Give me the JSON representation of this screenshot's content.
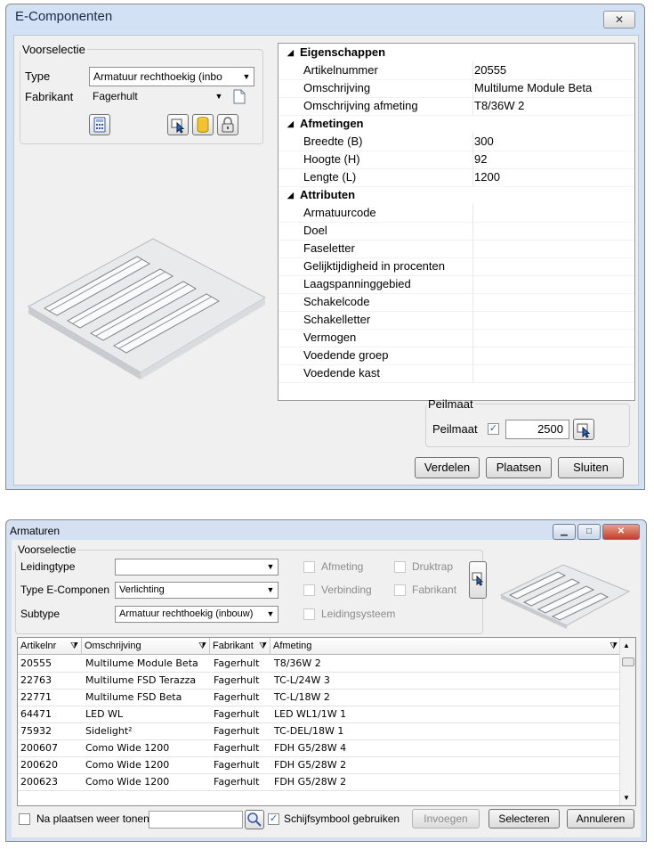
{
  "dialog": {
    "title": "E-Componenten",
    "close_glyph": "✕",
    "preselect": {
      "legend": "Voorselectie",
      "type_label": "Type",
      "type_value": "Armatuur rechthoekig (inbo",
      "manufacturer_label": "Fabrikant",
      "manufacturer_value": "Fagerhult"
    },
    "properties": {
      "group_properties": "Eigenschappen",
      "article_number_key": "Artikelnummer",
      "article_number_value": "20555",
      "description_key": "Omschrijving",
      "description_value": "Multilume Module Beta",
      "dimension_desc_key": "Omschrijving afmeting",
      "dimension_desc_value": "T8/36W 2",
      "group_dimensions": "Afmetingen",
      "width_key": "Breedte (B)",
      "width_value": "300",
      "height_key": "Hoogte (H)",
      "height_value": "92",
      "length_key": "Lengte (L)",
      "length_value": "1200",
      "group_attributes": "Attributen",
      "attr_fixture_code": "Armatuurcode",
      "attr_purpose": "Doel",
      "attr_phase_letter": "Faseletter",
      "attr_simultaneity": "Gelijktijdigheid in procenten",
      "attr_low_voltage_area": "Laagspanninggebied",
      "attr_switch_code": "Schakelcode",
      "attr_switch_letter": "Schakelletter",
      "attr_power": "Vermogen",
      "attr_feeding_group": "Voedende groep",
      "attr_feeding_cabinet": "Voedende kast"
    },
    "peilmaat": {
      "legend": "Peilmaat",
      "label": "Peilmaat",
      "checked": true,
      "value": "2500"
    },
    "buttons": {
      "distribute": "Verdelen",
      "place": "Plaatsen",
      "close": "Sluiten"
    }
  },
  "armaturen": {
    "title": "Armaturen",
    "preselect": {
      "legend": "Voorselectie",
      "pipe_type_label": "Leidingtype",
      "pipe_type_value": "",
      "etype_label": "Type E-Componen",
      "etype_value": "Verlichting",
      "subtype_label": "Subtype",
      "subtype_value": "Armatuur rechthoekig (inbouw)",
      "filter_dimension": "Afmeting",
      "filter_connection": "Verbinding",
      "filter_pipe_system": "Leidingsysteem",
      "filter_pressure_stage": "Druktrap",
      "filter_manufacturer": "Fabrikant"
    },
    "table": {
      "columns": [
        "Artikelnr",
        "Omschrijving",
        "Fabrikant",
        "Afmeting"
      ],
      "rows": [
        [
          "20555",
          "Multilume Module Beta",
          "Fagerhult",
          "T8/36W 2"
        ],
        [
          "22763",
          "Multilume FSD Terazza",
          "Fagerhult",
          "TC-L/24W 3"
        ],
        [
          "22771",
          "Multilume FSD Beta",
          "Fagerhult",
          "TC-L/18W 2"
        ],
        [
          "64471",
          "LED WL",
          "Fagerhult",
          "LED WL1/1W 1"
        ],
        [
          "75932",
          "Sidelight²",
          "Fagerhult",
          "TC-DEL/18W 1"
        ],
        [
          "200607",
          "Como Wide 1200",
          "Fagerhult",
          "FDH G5/28W 4"
        ],
        [
          "200620",
          "Como Wide 1200",
          "Fagerhult",
          "FDH G5/28W 2"
        ],
        [
          "200623",
          "Como Wide 1200",
          "Fagerhult",
          "FDH G5/28W 2"
        ]
      ]
    },
    "bottom": {
      "show_after_place": "Na plaatsen weer tonen",
      "show_after_place_checked": false,
      "search_value": "",
      "use_disk_symbol": "Schijfsymbool gebruiken",
      "use_disk_symbol_checked": true,
      "insert": "Invoegen",
      "select": "Selecteren",
      "cancel": "Annuleren"
    }
  },
  "colors": {
    "title_bg": "#d2e1f3",
    "client_bg": "#f0f0f0",
    "close_red": "#c0402a"
  }
}
